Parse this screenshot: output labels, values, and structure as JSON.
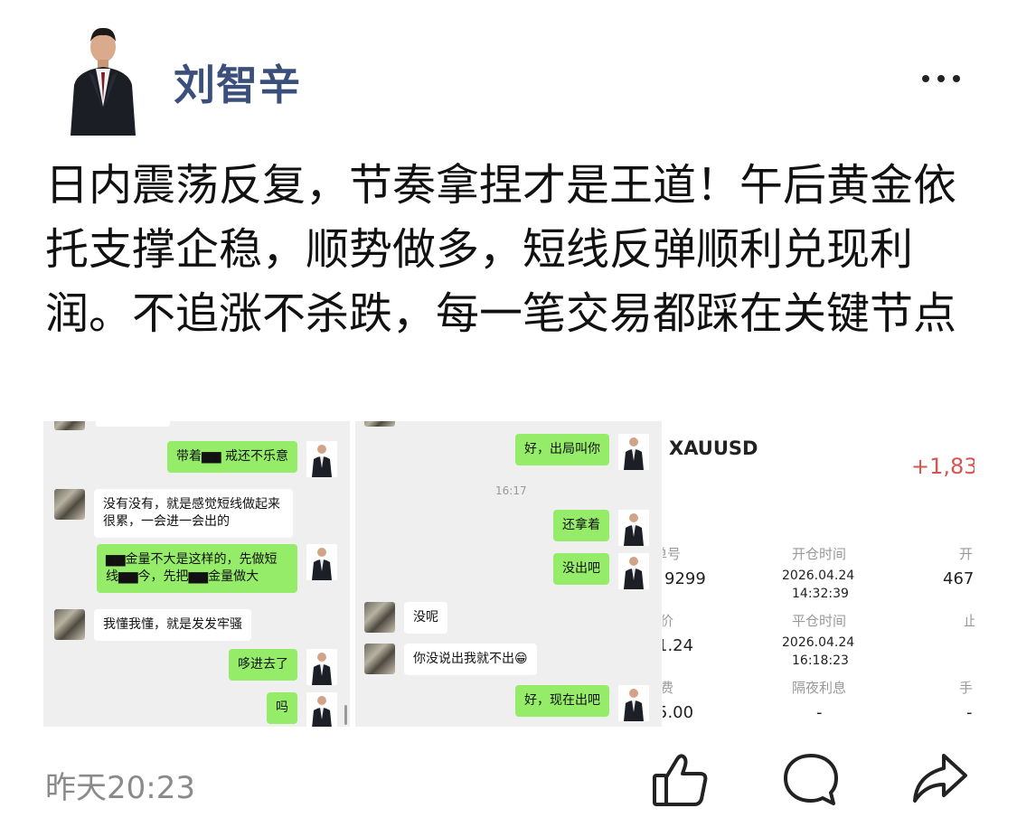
{
  "post": {
    "author": "刘智辛",
    "text": "日内震荡反复，节奏拿捏才是王道！午后黄金依托支撑企稳，顺势做多，短线反弹顺利兑现利润。不追涨不杀跌，每一笔交易都踩在关键节点",
    "time": "昨天20:23"
  },
  "icons": {
    "more": "more-icon",
    "like": "thumbs-up-icon",
    "comment": "comment-icon",
    "share": "share-icon"
  },
  "chat1": {
    "m1": "带着▆▆ 戒还不乐意",
    "m2": "没有没有，就是感觉短线做起来很累，一会进一会出的",
    "m3": "▆▆金量不大是这样的，先做短线▆▆今，先把▆▆金量做大",
    "m4": "我懂我懂，就是发发牢骚",
    "m5": "哆进去了",
    "m6": "吗"
  },
  "chat2": {
    "m1": "好，出局叫你",
    "time": "16:17",
    "m2": "还拿着",
    "m3": "没出吧",
    "m4": "没呢",
    "m5": "你没说出我就不出😁",
    "m6": "好，现在出吧"
  },
  "trade": {
    "symbol": "XAUUSD",
    "profit": "+1,83",
    "col1_label1": "单号",
    "col1_val1": "9299",
    "col2_label1": "开仓时间",
    "col2_date1": "2026.04.24",
    "col2_time1": "14:32:39",
    "col3_label1": "开",
    "col3_val1": "467",
    "col1_label2": "价",
    "col1_val2": "1.24",
    "col2_label2": "平仓时间",
    "col2_date2": "2026.04.24",
    "col2_time2": "16:18:23",
    "col3_label2": "止",
    "col1_label3": "费",
    "col1_val3": "5.00",
    "col2_label3": "隔夜利息",
    "col2_val3": "-",
    "col3_label3": "手",
    "col3_val3": "-"
  }
}
